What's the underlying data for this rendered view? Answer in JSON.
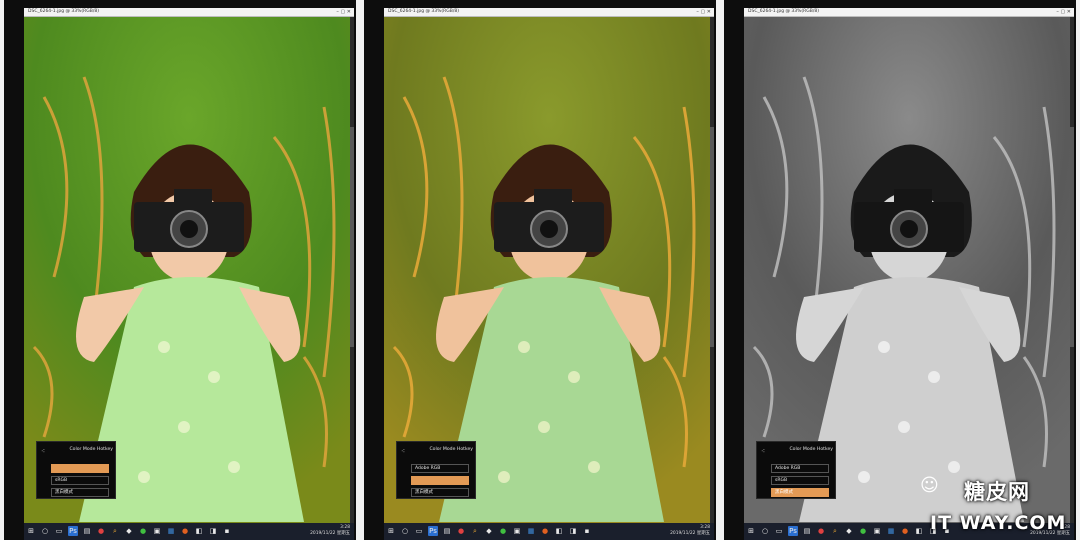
{
  "monitors": [
    {
      "window_title": "DSC_6264-1.jpg @ 33%(RGB/8)",
      "window_controls": "–  ▢  ✕",
      "mode_style": "color",
      "hotkey": {
        "logo_icon": "tri-dot-icon",
        "title": "Color Mode Hotkey",
        "items": [
          {
            "label": "",
            "active": true
          },
          {
            "label": "sRGB",
            "active": false
          },
          {
            "label": "黑白模式",
            "active": false
          }
        ]
      },
      "tray": {
        "time": "3:28",
        "date": "2019/11/22 星期五"
      }
    },
    {
      "window_title": "DSC_6264-1.jpg @ 33%(RGB/8)",
      "window_controls": "–  ▢  ✕",
      "mode_style": "warm",
      "hotkey": {
        "logo_icon": "tri-dot-icon",
        "title": "Color Mode Hotkey",
        "items": [
          {
            "label": "Adobe RGB",
            "active": false
          },
          {
            "label": "",
            "active": true
          },
          {
            "label": "黑白模式",
            "active": false
          }
        ]
      },
      "tray": {
        "time": "3:28",
        "date": "2019/11/22 星期五"
      }
    },
    {
      "window_title": "DSC_6264-1.jpg @ 33%(RGB/8)",
      "window_controls": "–  ▢  ✕",
      "mode_style": "mono",
      "hotkey": {
        "logo_icon": "tri-dot-icon",
        "title": "Color Mode Hotkey",
        "items": [
          {
            "label": "Adobe RGB",
            "active": false
          },
          {
            "label": "sRGB",
            "active": false
          },
          {
            "label": "黑白模式",
            "active": true
          }
        ]
      },
      "tray": {
        "time": "3:28",
        "date": "2019/11/22 星期五"
      }
    }
  ],
  "watermark": {
    "cn": "糖皮网",
    "en": "IT  WAY.COM"
  },
  "colors": {
    "hotkey_active": "#e39a55",
    "taskbar": "#1a1f2c",
    "bezel": "#0d0d0d"
  }
}
